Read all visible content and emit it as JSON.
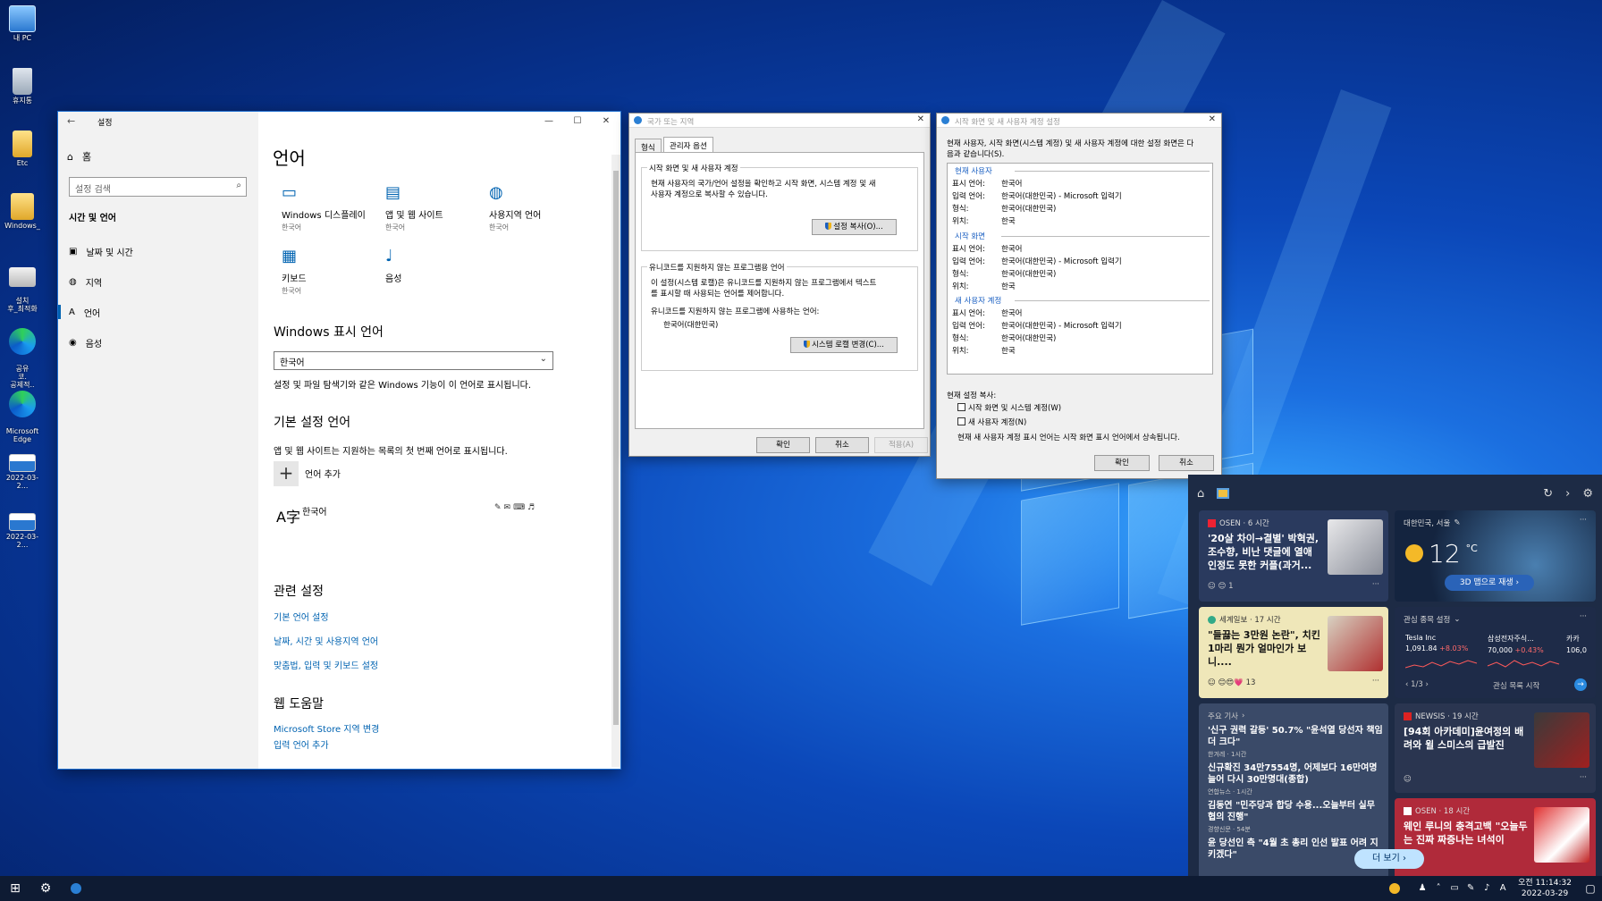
{
  "desktop": {
    "icons": [
      {
        "name": "mypc",
        "label": "내 PC",
        "icon": "pc-icon"
      },
      {
        "name": "recycle",
        "label": "휴지통",
        "icon": "recycle-bin-icon"
      },
      {
        "name": "etc",
        "label": "Etc",
        "icon": "folder-icon"
      },
      {
        "name": "windows",
        "label": "Windows_",
        "icon": "folder-icon"
      },
      {
        "name": "setup",
        "label": "설치\n후_최적화",
        "icon": "settings-icon"
      },
      {
        "name": "edge1",
        "label": "공유\n코.\n공제적..",
        "icon": "edge-icon"
      },
      {
        "name": "edge2",
        "label": "Microsoft\nEdge",
        "icon": "edge-icon"
      },
      {
        "name": "shot1",
        "label": "2022-03-2...",
        "icon": "image-icon"
      },
      {
        "name": "shot2",
        "label": "2022-03-2...",
        "icon": "image-icon"
      }
    ]
  },
  "settings": {
    "window_title": "설정",
    "home": "홈",
    "search_placeholder": "설정 검색",
    "section": "시간 및 언어",
    "nav": [
      "날짜 및 시간",
      "지역",
      "언어",
      "음성"
    ],
    "page_title": "언어",
    "tiles": [
      {
        "label": "Windows 디스플레이",
        "sub": "한국어"
      },
      {
        "label": "앱 및 웹 사이트",
        "sub": "한국어"
      },
      {
        "label": "사용지역 언어",
        "sub": "한국어"
      },
      {
        "label": "키보드",
        "sub": "한국어"
      },
      {
        "label": "음성",
        "sub": ""
      }
    ],
    "display_lang_heading": "Windows 표시 언어",
    "display_lang_value": "한국어",
    "display_lang_desc": "설정 및 파일 탐색기와 같은 Windows 기능이 이 언어로 표시됩니다.",
    "pref_heading": "기본 설정 언어",
    "pref_desc": "앱 및 웹 사이트는 지원하는 목록의 첫 번째 언어로 표시됩니다.",
    "add_lang": "언어 추가",
    "lang_item": "한국어",
    "related_heading": "관련 설정",
    "related_links": [
      "기본 언어 설정",
      "날짜, 시간 및 사용지역 언어",
      "맞춤법, 입력 및 키보드 설정"
    ],
    "web_help_heading": "웹 도움말",
    "web_help_links": [
      "Microsoft Store 지역 변경",
      "입력 언어 추가"
    ]
  },
  "region_dialog": {
    "title": "국가 또는 지역",
    "tabs": [
      "형식",
      "관리자 옵션"
    ],
    "group1_title": "시작 화면 및 새 사용자 계정",
    "group1_text": "현재 사용자의 국가/언어 설정을 확인하고 시작 화면, 시스템 계정 및 새\n사용자 계정으로 복사할 수 있습니다.",
    "copy_btn": "설정 복사(O)...",
    "group2_title": "유니코드를 지원하지 않는 프로그램용 언어",
    "group2_text": "이 설정(시스템 로캘)은 유니코드를 지원하지 않는 프로그램에서 텍스트\n를 표시할 때 사용되는 언어를 제어합니다.",
    "current_label": "유니코드를 지원하지 않는 프로그램에 사용하는 언어:",
    "current_value": "한국어(대한민국)",
    "locale_btn": "시스템 로캘 변경(C)...",
    "ok": "확인",
    "cancel": "취소",
    "apply": "적용(A)"
  },
  "welcome_dialog": {
    "title": "시작 화면 및 새 사용자 계정 설정",
    "intro": "현재 사용자, 시작 화면(시스템 계정) 및 새 사용자 계정에 대한 설정 화면은 다\n음과 같습니다(S).",
    "sections": [
      {
        "title": "현재 사용자",
        "rows": [
          [
            "표시 언어:",
            "한국어"
          ],
          [
            "입력 언어:",
            "한국어(대한민국) - Microsoft 입력기"
          ],
          [
            "형식:",
            "한국어(대한민국)"
          ],
          [
            "위치:",
            "한국"
          ]
        ]
      },
      {
        "title": "시작 화면",
        "rows": [
          [
            "표시 언어:",
            "한국어"
          ],
          [
            "입력 언어:",
            "한국어(대한민국) - Microsoft 입력기"
          ],
          [
            "형식:",
            "한국어(대한민국)"
          ],
          [
            "위치:",
            "한국"
          ]
        ]
      },
      {
        "title": "새 사용자 계정",
        "rows": [
          [
            "표시 언어:",
            "한국어"
          ],
          [
            "입력 언어:",
            "한국어(대한민국) - Microsoft 입력기"
          ],
          [
            "형식:",
            "한국어(대한민국)"
          ],
          [
            "위치:",
            "한국"
          ]
        ]
      }
    ],
    "copy_label": "현재 설정 복사:",
    "check1": "시작 화면 및 시스템 계정(W)",
    "check2": "새 사용자 계정(N)",
    "note": "현재 새 사용자 계정 표시 언어는 시작 화면 표시 언어에서 상속됩니다.",
    "ok": "확인",
    "cancel": "취소"
  },
  "widgets": {
    "news1": {
      "source": "OSEN · 6 시간",
      "headline": "'20살 차이→결별' 박혁권, 조수향, 비난 댓글에 열애 인정도 못한 커플(과거...",
      "reactions": "1"
    },
    "weather": {
      "location": "대한민국, 서울",
      "temp": "12",
      "unit": "°C",
      "button": "3D 맵으로 재생"
    },
    "news2": {
      "source": "세계일보 · 17 시간",
      "headline": "\"들끓는 3만원 논란\", 치킨 1마리 뭔가 얼마인가 보니....",
      "reactions": "13"
    },
    "stocks": {
      "title": "관심 종목 설정",
      "items": [
        {
          "name": "Tesla Inc",
          "price": "1,091.84",
          "change": "+8.03%"
        },
        {
          "name": "삼성전자주식...",
          "price": "70,000",
          "change": "+0.43%"
        },
        {
          "name": "카카",
          "price": "106,0",
          "change": ""
        }
      ],
      "page": "1/3",
      "start": "관심 목록 시작"
    },
    "top_stories": {
      "title": "주요 기사",
      "items": [
        {
          "headline": "'신구 권력 갈등' 50.7% \"윤석열 당선자 책임 더 크다\"",
          "meta": "한겨레 · 1시간"
        },
        {
          "headline": "신규확진 34만7554명, 어제보다 16만여명 늘어 다시 30만명대(종합)",
          "meta": "연합뉴스 · 1시간"
        },
        {
          "headline": "김동연 \"민주당과 합당 수용...오늘부터 실무 협의 진행\"",
          "meta": "경향신문 · 54분"
        },
        {
          "headline": "윤 당선인 측 \"4월 초 총리 인선 발표 어려 지키겠다\"",
          "meta": ""
        }
      ]
    },
    "news3": {
      "source": "NEWSIS · 19 시간",
      "headline": "[94회 아카데미]윤여정의 배려와 윌 스미스의 급발진"
    },
    "news4": {
      "source": "OSEN · 18 시간",
      "headline": "웨인 루니의 충격고백 \"오늘두는 진짜 짜증나는 녀석이"
    },
    "more": "더 보기"
  },
  "taskbar": {
    "time": "오전 11:14:32",
    "date": "2022-03-29"
  }
}
